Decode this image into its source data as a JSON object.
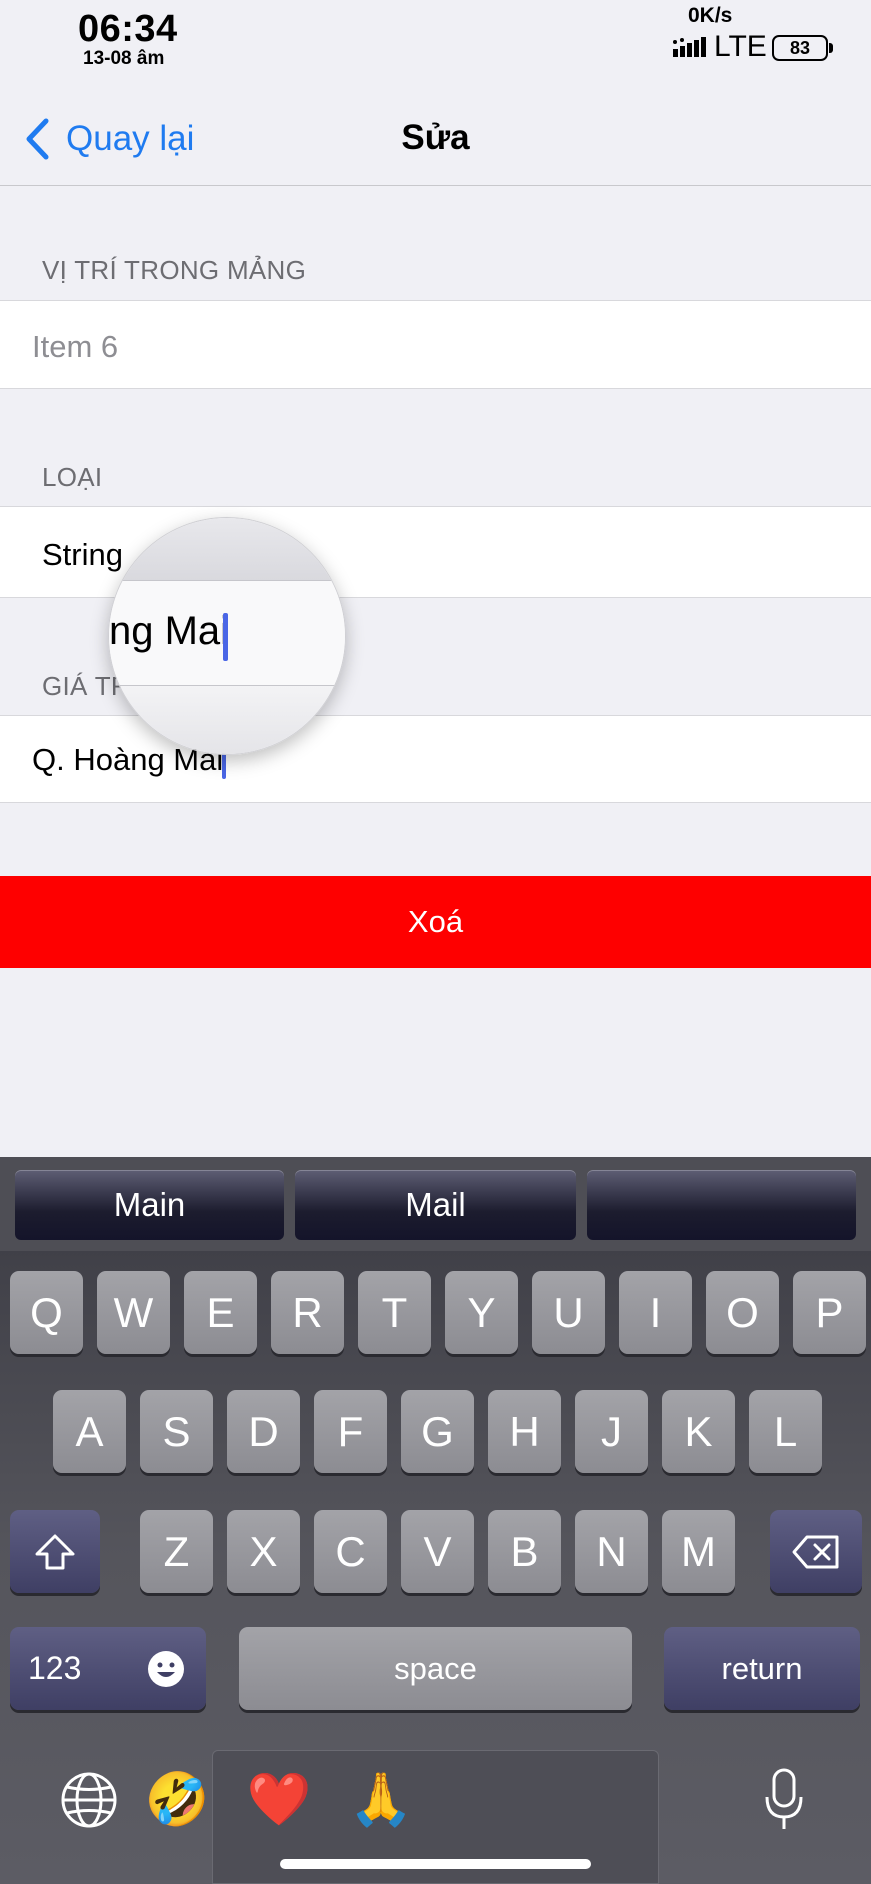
{
  "status_bar": {
    "time": "06:34",
    "date": "13-08 âm",
    "speed": "0K/s",
    "network": "LTE",
    "battery": "83"
  },
  "nav": {
    "back_label": "Quay lại",
    "title": "Sửa"
  },
  "form": {
    "position_header": "VỊ TRÍ TRONG MẢNG",
    "position_placeholder": "Item 6",
    "type_header": "LOẠI",
    "type_value": "String",
    "value_header": "GIÁ TRỊ",
    "value_text": "Q. Hoàng Mai",
    "magnifier_text": "ng Mai"
  },
  "delete_label": "Xoá",
  "keyboard": {
    "suggestions": [
      "Main",
      "Mail",
      ""
    ],
    "row1": [
      "Q",
      "W",
      "E",
      "R",
      "T",
      "Y",
      "U",
      "I",
      "O",
      "P"
    ],
    "row2": [
      "A",
      "S",
      "D",
      "F",
      "G",
      "H",
      "J",
      "K",
      "L"
    ],
    "row3": [
      "Z",
      "X",
      "C",
      "V",
      "B",
      "N",
      "M"
    ],
    "numbers_label": "123",
    "space_label": "space",
    "return_label": "return",
    "emoji_tray": [
      "🤣",
      "❤️",
      "🙏"
    ]
  },
  "colors": {
    "accent": "#1f7bf0",
    "delete": "#fe0000",
    "cursor": "#4a66e6"
  }
}
